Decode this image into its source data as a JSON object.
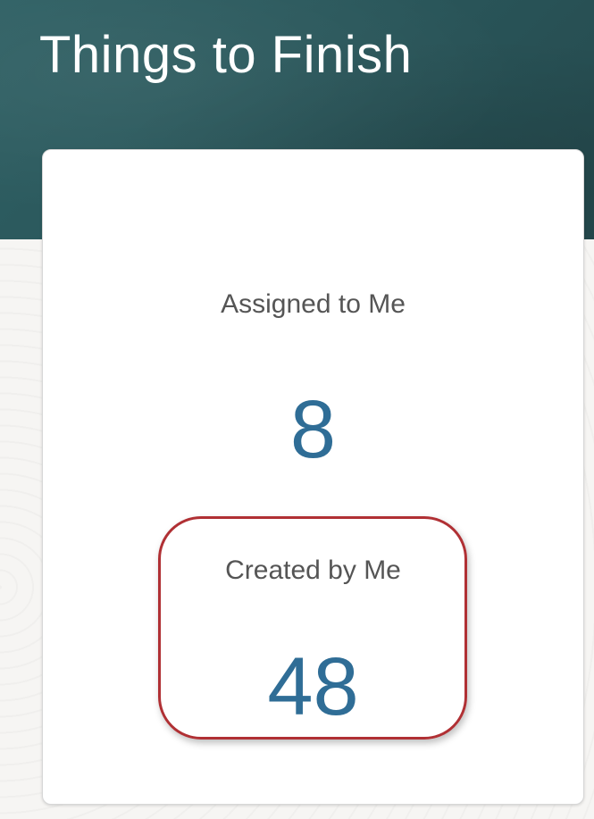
{
  "header": {
    "title": "Things to Finish"
  },
  "metrics": {
    "assigned": {
      "label": "Assigned to Me",
      "value": "8"
    },
    "created": {
      "label": "Created by Me",
      "value": "48"
    }
  },
  "colors": {
    "header_band": "#2a575b",
    "value_text": "#2f6d96",
    "highlight": "#b03034"
  }
}
